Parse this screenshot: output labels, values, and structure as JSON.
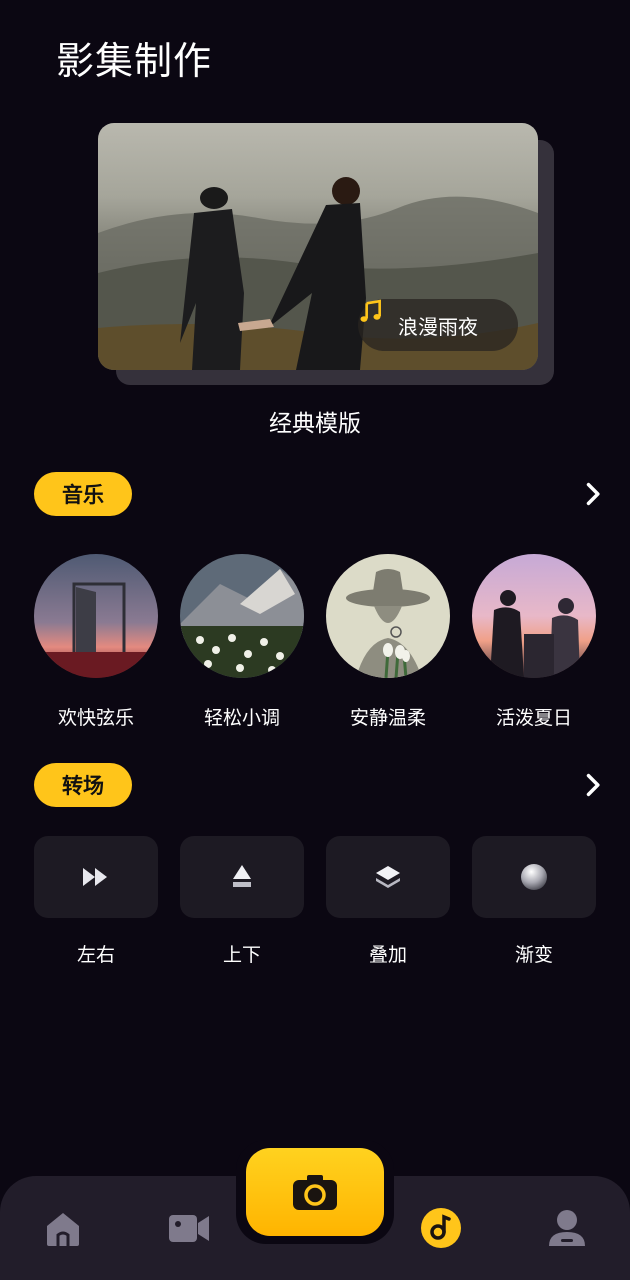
{
  "header": {
    "title": "影集制作"
  },
  "hero": {
    "music_tag": "浪漫雨夜",
    "caption": "经典模版"
  },
  "music": {
    "section_label": "音乐",
    "items": [
      {
        "label": "欢快弦乐"
      },
      {
        "label": "轻松小调"
      },
      {
        "label": "安静温柔"
      },
      {
        "label": "活泼夏日"
      }
    ]
  },
  "transitions": {
    "section_label": "转场",
    "items": [
      {
        "label": "左右",
        "icon": "fast-forward-icon"
      },
      {
        "label": "上下",
        "icon": "stack-up-icon"
      },
      {
        "label": "叠加",
        "icon": "layers-icon"
      },
      {
        "label": "渐变",
        "icon": "gradient-sphere-icon"
      }
    ]
  },
  "nav": {
    "items": [
      {
        "icon": "home-icon",
        "active": false
      },
      {
        "icon": "video-camera-icon",
        "active": false
      },
      {
        "icon": "camera-icon",
        "active": true
      },
      {
        "icon": "music-note-icon",
        "active": false
      },
      {
        "icon": "profile-icon",
        "active": false
      }
    ]
  },
  "colors": {
    "background": "#0b0712",
    "accent": "#ffc51a",
    "tile": "#1d1a23",
    "nav_bar": "#221d2a",
    "nav_icon": "#7f7a8c"
  }
}
